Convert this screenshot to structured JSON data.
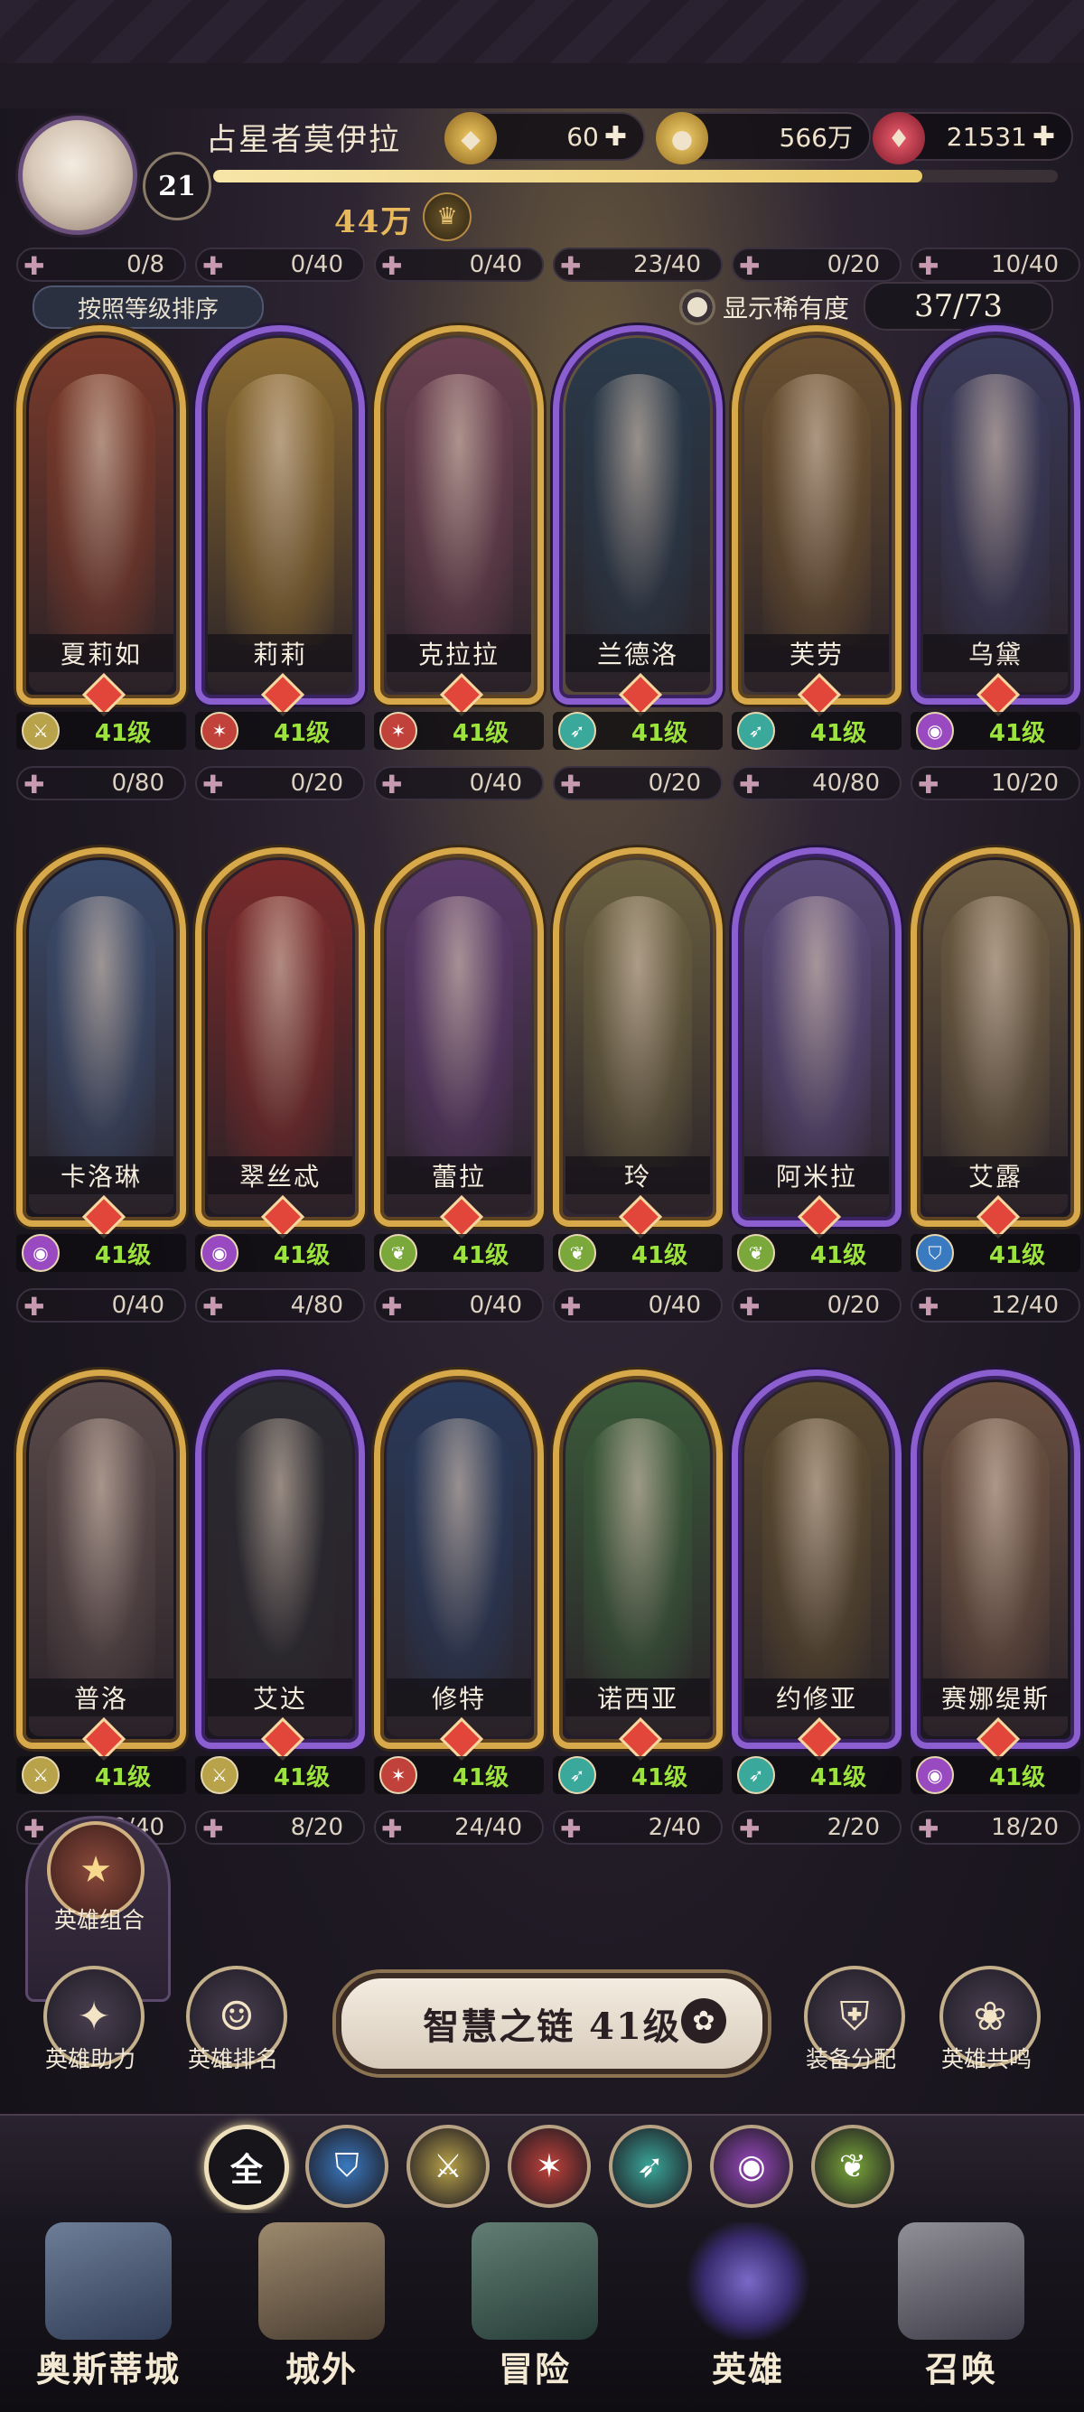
{
  "player": {
    "name": "占星者莫伊拉",
    "level": "21",
    "xp_fraction": 0.84,
    "power": "44万"
  },
  "resources": [
    {
      "name": "stamina",
      "icon": "gold-badge-icon",
      "value": "60",
      "plus": "✚",
      "color": "#d9a23c"
    },
    {
      "name": "gold",
      "icon": "gold-coin-icon",
      "value": "566万",
      "plus": "",
      "color": "#c89a3a"
    },
    {
      "name": "gem",
      "icon": "red-gem-icon",
      "value": "21531",
      "plus": "✚",
      "color": "#c0304a"
    }
  ],
  "toolbar": {
    "sort_label": "按照等级排序",
    "rarity_label": "显示稀有度",
    "hero_count": "37/73"
  },
  "top_fragments": [
    "0/8",
    "0/40",
    "0/40",
    "23/40",
    "0/20",
    "10/40"
  ],
  "heroes": [
    {
      "name": "夏莉如",
      "level": "41级",
      "frame": "gold",
      "class_color": "#b8a24a",
      "class_icon": "sword-icon",
      "tint": "#7a3a2a",
      "fragments": "0/80"
    },
    {
      "name": "莉莉",
      "level": "41级",
      "frame": "purple",
      "class_color": "#c0423a",
      "class_icon": "claw-icon",
      "tint": "#8a6a30",
      "fragments": "0/20"
    },
    {
      "name": "克拉拉",
      "level": "41级",
      "frame": "gold",
      "class_color": "#c0423a",
      "class_icon": "claw-icon",
      "tint": "#6a4050",
      "fragments": "0/40"
    },
    {
      "name": "兰德洛",
      "level": "41级",
      "frame": "purple",
      "class_color": "#3aa89a",
      "class_icon": "arrows-icon",
      "tint": "#2a3a4a",
      "fragments": "0/20"
    },
    {
      "name": "芙劳",
      "level": "41级",
      "frame": "gold",
      "class_color": "#3aa89a",
      "class_icon": "arrows-icon",
      "tint": "#6a5030",
      "fragments": "40/80"
    },
    {
      "name": "乌黛",
      "level": "41级",
      "frame": "purple",
      "class_color": "#9a4ac0",
      "class_icon": "orb-icon",
      "tint": "#3a3a5a",
      "fragments": "10/20"
    },
    {
      "name": "卡洛琳",
      "level": "41级",
      "frame": "gold",
      "class_color": "#9a4ac0",
      "class_icon": "orb-icon",
      "tint": "#3a4a6a",
      "fragments": "0/40"
    },
    {
      "name": "翠丝忒",
      "level": "41级",
      "frame": "gold",
      "class_color": "#9a4ac0",
      "class_icon": "orb-icon",
      "tint": "#7a2a2a",
      "fragments": "4/80"
    },
    {
      "name": "蕾拉",
      "level": "41级",
      "frame": "gold",
      "class_color": "#7aa83a",
      "class_icon": "leaf-icon",
      "tint": "#5a3a6a",
      "fragments": "0/40"
    },
    {
      "name": "玲",
      "level": "41级",
      "frame": "gold",
      "class_color": "#7aa83a",
      "class_icon": "leaf-icon",
      "tint": "#6a6040",
      "fragments": "0/40"
    },
    {
      "name": "阿米拉",
      "level": "41级",
      "frame": "purple",
      "class_color": "#7aa83a",
      "class_icon": "leaf-icon",
      "tint": "#5a4a7a",
      "fragments": "0/20"
    },
    {
      "name": "艾露",
      "level": "41级",
      "frame": "gold",
      "class_color": "#3a7ac0",
      "class_icon": "shield-icon",
      "tint": "#6a5a40",
      "fragments": "12/40"
    },
    {
      "name": "普洛",
      "level": "41级",
      "frame": "gold",
      "class_color": "#b8a24a",
      "class_icon": "sword-icon",
      "tint": "#5a4a4a",
      "fragments": "0/40"
    },
    {
      "name": "艾达",
      "level": "41级",
      "frame": "purple",
      "class_color": "#b8a24a",
      "class_icon": "sword-icon",
      "tint": "#2a2a30",
      "fragments": "8/20"
    },
    {
      "name": "修特",
      "level": "41级",
      "frame": "gold",
      "class_color": "#c0423a",
      "class_icon": "claw-icon",
      "tint": "#2a3a5a",
      "fragments": "24/40"
    },
    {
      "name": "诺西亚",
      "level": "41级",
      "frame": "gold",
      "class_color": "#3aa89a",
      "class_icon": "arrows-icon",
      "tint": "#3a5a3a",
      "fragments": "2/40"
    },
    {
      "name": "约修亚",
      "level": "41级",
      "frame": "purple",
      "class_color": "#3aa89a",
      "class_icon": "arrows-icon",
      "tint": "#5a4a30",
      "fragments": "2/20"
    },
    {
      "name": "赛娜缇斯",
      "level": "41级",
      "frame": "purple",
      "class_color": "#9a4ac0",
      "class_icon": "orb-icon",
      "tint": "#6a5040",
      "fragments": "18/20"
    }
  ],
  "actions": {
    "combo": "英雄组合",
    "assist": "英雄助力",
    "ranking": "英雄排名",
    "wisdom_chain": "智慧之链 41级",
    "equip_assign": "装备分配",
    "resonance": "英雄共鸣"
  },
  "filters": [
    {
      "label": "全",
      "icon": "all-filter",
      "color": "#17141a"
    },
    {
      "label": "",
      "icon": "shield-icon",
      "color": "#3a7ac0"
    },
    {
      "label": "",
      "icon": "sword-icon",
      "color": "#b8a24a"
    },
    {
      "label": "",
      "icon": "claw-icon",
      "color": "#c0423a"
    },
    {
      "label": "",
      "icon": "arrows-icon",
      "color": "#3aa89a"
    },
    {
      "label": "",
      "icon": "orb-icon",
      "color": "#9a4ac0"
    },
    {
      "label": "",
      "icon": "leaf-icon",
      "color": "#7aa83a"
    }
  ],
  "nav": [
    {
      "label": "奥斯蒂城",
      "active": false
    },
    {
      "label": "城外",
      "active": false
    },
    {
      "label": "冒险",
      "active": false
    },
    {
      "label": "英雄",
      "active": true
    },
    {
      "label": "召唤",
      "active": false
    }
  ]
}
